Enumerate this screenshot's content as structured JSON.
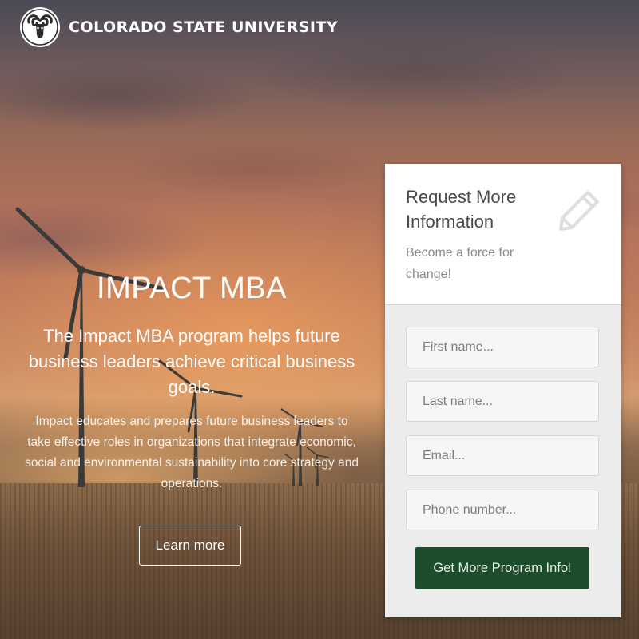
{
  "brand": {
    "name": "COLORADO STATE UNIVERSITY",
    "logo_icon": "ram-head-icon"
  },
  "hero": {
    "title_strong": "IMPACT",
    "title_rest": " MBA",
    "subtitle_pre": "The ",
    "subtitle_em": "Impact",
    "subtitle_post": " MBA program helps future business leaders achieve critical business goals.",
    "description": "Impact educates and prepares future business leaders to take effective roles in organizations that integrate economic, social and environmental sustainability into core strategy and operations.",
    "button_label": "Learn more"
  },
  "form": {
    "title": "Request More Information",
    "tagline": "Become a force for change!",
    "icon": "pencil-icon",
    "fields": {
      "first_name": {
        "placeholder": "First name...",
        "value": ""
      },
      "last_name": {
        "placeholder": "Last name...",
        "value": ""
      },
      "email": {
        "placeholder": "Email...",
        "value": ""
      },
      "phone": {
        "placeholder": "Phone number...",
        "value": ""
      }
    },
    "submit_label": "Get More Program Info!"
  },
  "colors": {
    "brand_green": "#1e4d2b",
    "panel_background": "#ececec",
    "text_white": "#ffffff"
  }
}
